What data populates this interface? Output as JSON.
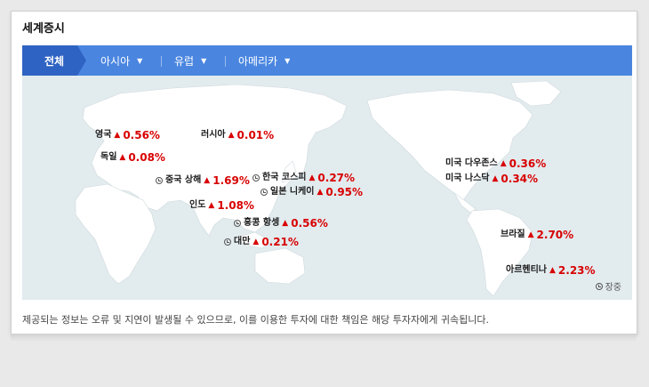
{
  "title": "세계증시",
  "tabs": {
    "active": "전체",
    "items": [
      "아시아",
      "유럽",
      "아메리카"
    ]
  },
  "markets": [
    {
      "name": "영국",
      "change": "0.56%",
      "clock": false
    },
    {
      "name": "독일",
      "change": "0.08%",
      "clock": false
    },
    {
      "name": "러시아",
      "change": "0.01%",
      "clock": false
    },
    {
      "name": "중국 상해",
      "change": "1.69%",
      "clock": true
    },
    {
      "name": "한국 코스피",
      "change": "0.27%",
      "clock": true
    },
    {
      "name": "일본 니케이",
      "change": "0.95%",
      "clock": true
    },
    {
      "name": "인도",
      "change": "1.08%",
      "clock": false
    },
    {
      "name": "홍콩 항셍",
      "change": "0.56%",
      "clock": true
    },
    {
      "name": "대만",
      "change": "0.21%",
      "clock": true
    },
    {
      "name": "미국 다우존스",
      "change": "0.36%",
      "clock": false
    },
    {
      "name": "미국 나스닥",
      "change": "0.34%",
      "clock": false
    },
    {
      "name": "브라질",
      "change": "2.70%",
      "clock": false
    },
    {
      "name": "아르헨티나",
      "change": "2.23%",
      "clock": false
    }
  ],
  "up_arrow": "▲",
  "legend": "장중",
  "disclaimer": "제공되는 정보는 오류 및 지연이 발생될 수 있으므로, 이를 이용한 투자에 대한 책임은 해당 투자자에게 귀속됩니다.",
  "colors": {
    "tab_bar": "#4a86e0",
    "tab_active": "#2f63c3",
    "map_bg": "#e2ebee",
    "land": "#ffffff",
    "up": "#d80000"
  }
}
